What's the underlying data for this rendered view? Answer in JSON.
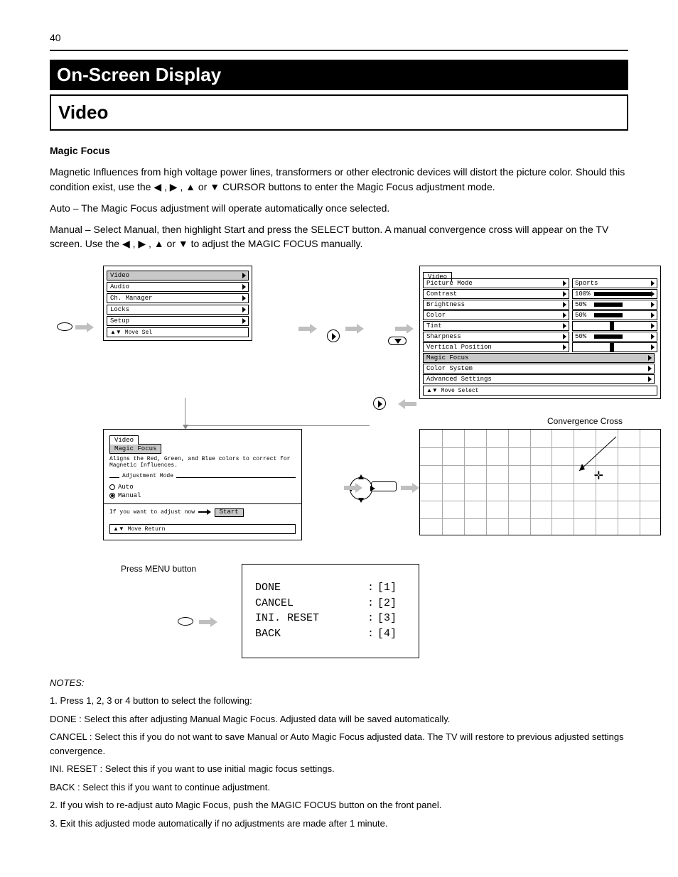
{
  "page_number": "40",
  "section_heading": "On-Screen Display",
  "panel_heading": "Video",
  "subsection_title": "Magic Focus",
  "intro_paragraph_1_prefix": "Magnetic Influences from high voltage power lines, transformers or other electronic devices will distort the picture color. Should this condition exist, use the ",
  "intro_paragraph_1_arrows": "◀ , ▶ , ▲ or ▼ ",
  "intro_paragraph_1_suffix": "CURSOR buttons to enter the Magic Focus adjustment mode.",
  "steps": {
    "s1": "Auto – The Magic Focus adjustment will operate automatically once selected.",
    "s2a": "Manual – Select Manual, then highlight Start and press the SELECT button. A manual convergence cross will appear on the TV screen. Use the ",
    "s2b": "◀ , ▶ , ▲ or ▼ ",
    "s2c": "to adjust the MAGIC FOCUS manually."
  },
  "osd_main": {
    "items": [
      "Video",
      "Audio",
      "Ch. Manager",
      "Locks",
      "Setup"
    ],
    "footer": "Move      Sel"
  },
  "osd_video": {
    "tab": "Video",
    "rows": [
      {
        "label": "Picture Mode",
        "value": "Sports",
        "type": "text"
      },
      {
        "label": "Contrast",
        "value": "100%",
        "type": "bar",
        "pct": 100
      },
      {
        "label": "Brightness",
        "value": "50%",
        "type": "bar",
        "pct": 50
      },
      {
        "label": "Color",
        "value": "50%",
        "type": "bar",
        "pct": 50
      },
      {
        "label": "Tint",
        "value": "",
        "type": "center"
      },
      {
        "label": "Sharpness",
        "value": "50%",
        "type": "bar",
        "pct": 50
      },
      {
        "label": "Vertical Position",
        "value": "",
        "type": "center"
      },
      {
        "label": "Magic Focus",
        "value": null,
        "type": "none",
        "sel": true
      },
      {
        "label": "Color System",
        "value": null,
        "type": "none"
      },
      {
        "label": "Advanced Settings",
        "value": null,
        "type": "none"
      }
    ],
    "footer": "Move     Select"
  },
  "osd_focus": {
    "tab": "Video",
    "title": "Magic Focus",
    "desc": "Aligns the Red, Green, and Blue colors to correct for Magnetic Influences.",
    "legend": "Adjustment Mode",
    "opt_auto": "Auto",
    "opt_manual": "Manual",
    "start_label": "Start",
    "start_line": "If you want to adjust now",
    "footer": "Move     Return"
  },
  "grid_label": "Convergence Cross",
  "press_menu_row": "Press MENU button",
  "menu_box": {
    "done": {
      "k": "DONE",
      "v": "[1]"
    },
    "cancel": {
      "k": "CANCEL",
      "v": "[2]"
    },
    "reset": {
      "k": "INI. RESET",
      "v": "[3]"
    },
    "back": {
      "k": "BACK",
      "v": "[4]"
    }
  },
  "notes": {
    "n1": "1. Press 1, 2, 3 or 4 button to select the following:",
    "done_lead": "DONE :  ",
    "done_body": "Select this after adjusting Manual Magic Focus. Adjusted data will be saved automatically.",
    "cancel_lead": "CANCEL :  ",
    "cancel_body": "Select this if you do not want to save Manual or Auto Magic Focus adjusted data. The TV will restore to previous adjusted settings convergence.",
    "reset_lead": "INI. RESET :  ",
    "reset_body": "Select this if you want to use initial magic focus settings.",
    "back_lead": "BACK :  ",
    "back_body": "Select this if you want to continue adjustment.",
    "n2": "2. If you wish to re-adjust auto Magic Focus, push the MAGIC FOCUS button on the front panel.",
    "n3": "3. Exit this adjusted mode automatically if no adjustments are made after 1 minute."
  }
}
